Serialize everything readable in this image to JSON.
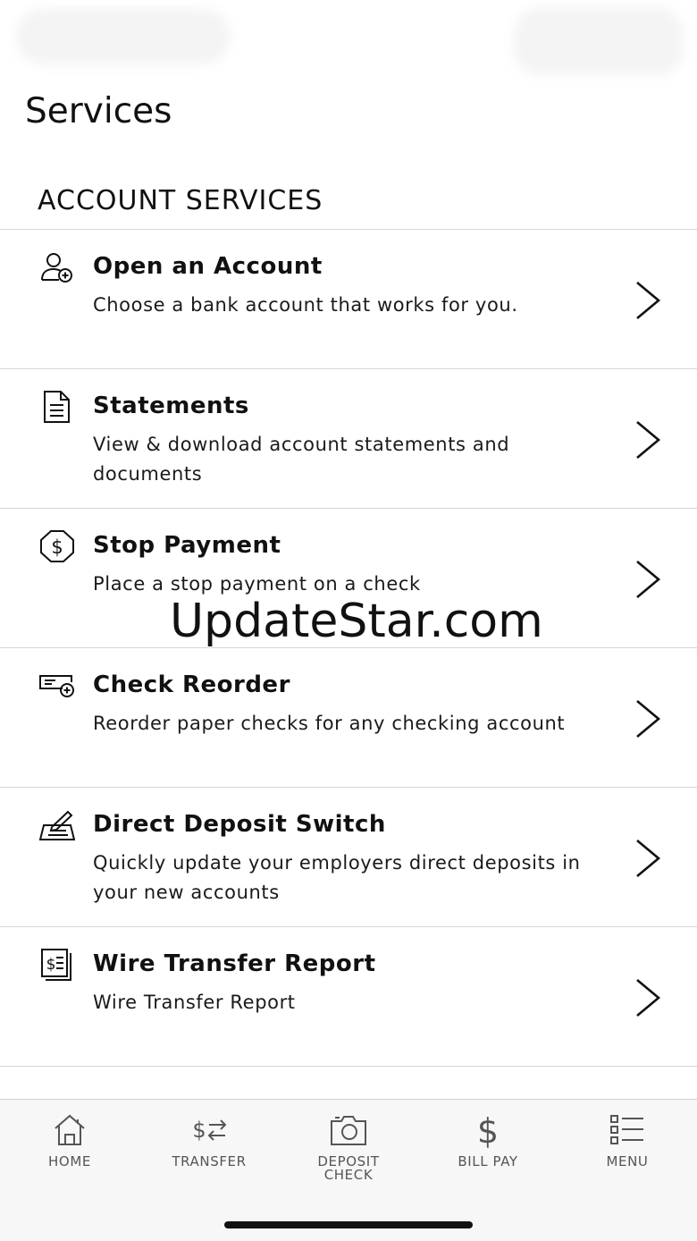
{
  "page": {
    "title": "Services"
  },
  "section": {
    "header": "ACCOUNT SERVICES"
  },
  "services": [
    {
      "icon": "user-add-icon",
      "title": "Open an Account",
      "description": "Choose a bank account that works for you."
    },
    {
      "icon": "document-icon",
      "title": "Statements",
      "description": "View & download account statements and documents"
    },
    {
      "icon": "stop-dollar-icon",
      "title": "Stop Payment",
      "description": "Place a stop payment on a check"
    },
    {
      "icon": "check-add-icon",
      "title": "Check Reorder",
      "description": "Reorder paper checks for any checking account"
    },
    {
      "icon": "signature-icon",
      "title": "Direct Deposit Switch",
      "description": "Quickly update your employers direct deposits in your new accounts"
    },
    {
      "icon": "wire-report-icon",
      "title": "Wire Transfer Report",
      "description": "Wire Transfer Report"
    }
  ],
  "watermark": "UpdateStar.com",
  "tabbar": {
    "home": "HOME",
    "transfer": "TRANSFER",
    "deposit_check_line1": "DEPOSIT",
    "deposit_check_line2": "CHECK",
    "bill_pay": "BILL PAY",
    "menu": "MENU"
  },
  "colors": {
    "text": "#111111",
    "divider": "#d6d6d6",
    "tabbar_bg": "#f7f7f7",
    "tab_label": "#555555"
  }
}
